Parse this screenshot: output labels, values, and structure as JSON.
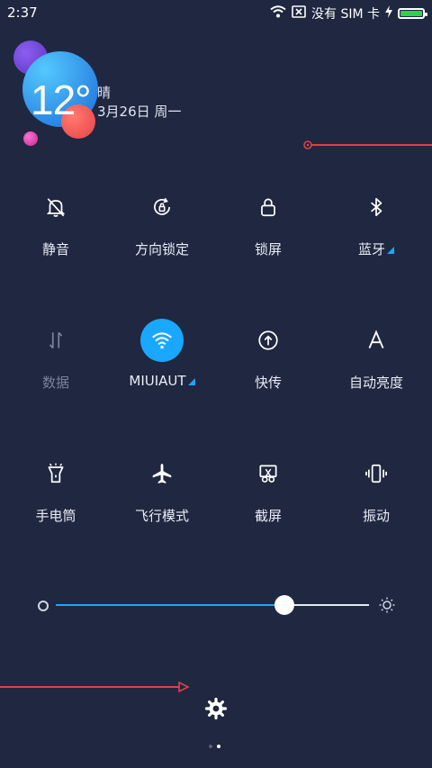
{
  "status_bar": {
    "time": "2:37",
    "sim_text": "没有 SIM 卡",
    "battery_level_percent": 100
  },
  "weather": {
    "temperature": "12°",
    "condition": "晴",
    "date": "3月26日 周一"
  },
  "tiles": [
    {
      "label": "静音",
      "icon": "bell-slash-icon",
      "active": false
    },
    {
      "label": "方向锁定",
      "icon": "rotation-lock-icon",
      "active": false
    },
    {
      "label": "锁屏",
      "icon": "lock-icon",
      "active": false
    },
    {
      "label": "蓝牙",
      "icon": "bluetooth-icon",
      "active": false,
      "has_more": true
    },
    {
      "label": "数据",
      "icon": "mobile-data-icon",
      "active": false,
      "dimmed": true
    },
    {
      "label": "MIUIAUT",
      "icon": "wifi-icon",
      "active": true,
      "has_more": true
    },
    {
      "label": "快传",
      "icon": "share-icon",
      "active": false
    },
    {
      "label": "自动亮度",
      "icon": "auto-brightness-icon",
      "active": false
    },
    {
      "label": "手电筒",
      "icon": "flashlight-icon",
      "active": false
    },
    {
      "label": "飞行模式",
      "icon": "airplane-icon",
      "active": false
    },
    {
      "label": "截屏",
      "icon": "screenshot-icon",
      "active": false
    },
    {
      "label": "振动",
      "icon": "vibrate-icon",
      "active": false
    }
  ],
  "brightness": {
    "level": 0.73
  },
  "pager": {
    "count": 2,
    "current": 1
  },
  "colors": {
    "background": "#1f2741",
    "accent": "#1aa7ff",
    "annotation": "#e0404a"
  }
}
